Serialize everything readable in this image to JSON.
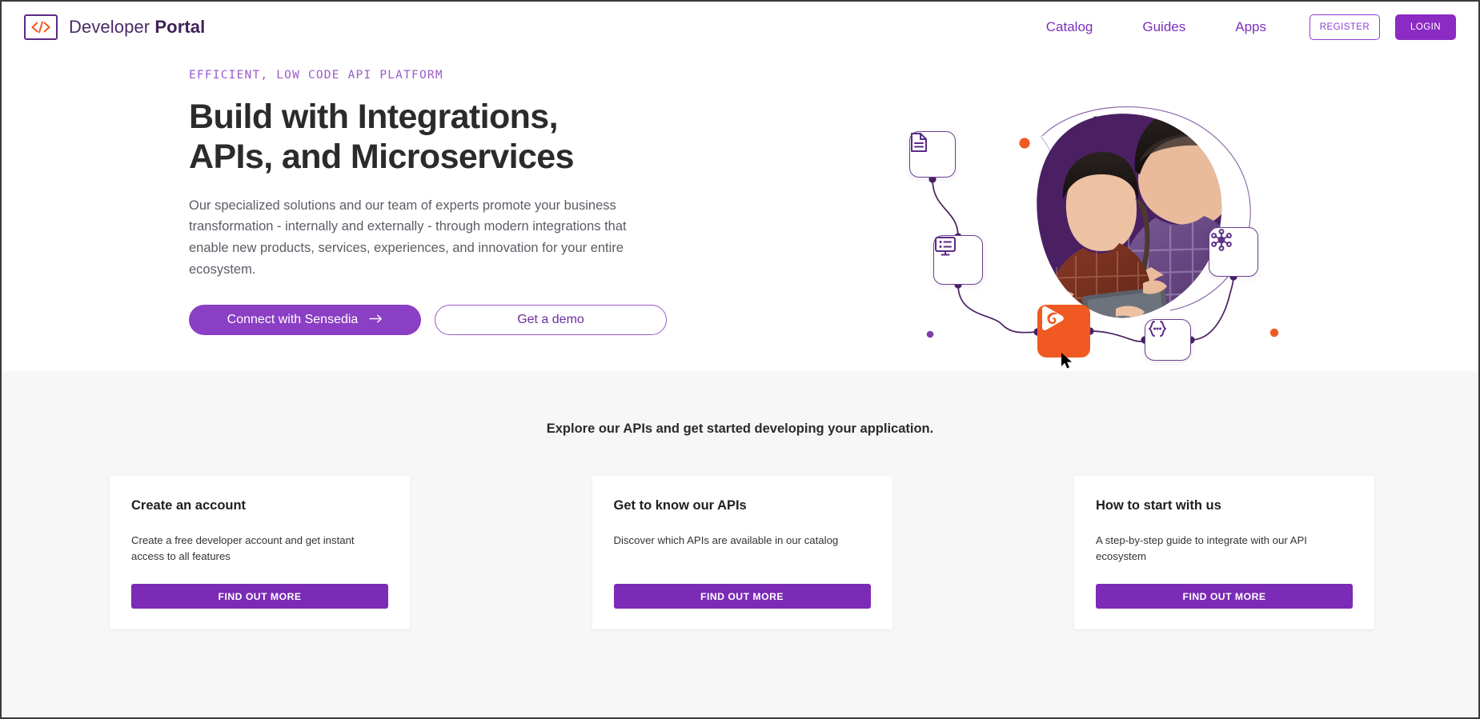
{
  "header": {
    "brand": {
      "prefix": "Developer ",
      "suffix": "Portal",
      "logo_icon": "code-brackets-icon"
    },
    "nav": [
      {
        "label": "Catalog",
        "name": "nav-link-catalog"
      },
      {
        "label": "Guides",
        "name": "nav-link-guides"
      },
      {
        "label": "Apps",
        "name": "nav-link-apps"
      }
    ],
    "register_label": "REGISTER",
    "login_label": "LOGIN"
  },
  "hero": {
    "eyebrow": "EFFICIENT, LOW CODE API PLATFORM",
    "title_line1": "Build with Integrations,",
    "title_line2": "APIs, and Microservices",
    "description": "Our specialized solutions and our team of experts promote your business transformation - internally and externally - through modern integrations that enable new products, services, experiences, and innovation for your entire ecosystem.",
    "primary_button": "Connect with Sensedia",
    "primary_button_icon": "arrow-right-icon",
    "secondary_button": "Get a demo",
    "art": {
      "icons": [
        {
          "name": "document-icon",
          "label": "document"
        },
        {
          "name": "monitor-list-icon",
          "label": "monitor with list"
        },
        {
          "name": "network-hub-icon",
          "label": "network hub"
        },
        {
          "name": "curly-braces-icon",
          "label": "code braces"
        },
        {
          "name": "sensedia-logo-icon",
          "label": "Sensedia logo"
        }
      ],
      "photo_alt": "Two people looking at a tablet"
    }
  },
  "explore": {
    "heading": "Explore our APIs and get started developing your application.",
    "cards": [
      {
        "title": "Create an account",
        "description": "Create a free developer account and get instant access to all features",
        "button": "FIND OUT MORE"
      },
      {
        "title": "Get to know our APIs",
        "description": "Discover which APIs are available in our catalog",
        "button": "FIND OUT MORE"
      },
      {
        "title": "How to start with us",
        "description": "A step-by-step guide to integrate with our API ecosystem",
        "button": "FIND OUT MORE"
      }
    ]
  },
  "colors": {
    "brand_purple": "#5B2A86",
    "accent_purple": "#8B2BC4",
    "button_purple": "#7B2BB5",
    "orange": "#F05A22",
    "blob_purple": "#4A2063",
    "section_bg": "#f7f7f7",
    "text_dark": "#2b2b2b",
    "text_muted": "#5c5c66"
  }
}
